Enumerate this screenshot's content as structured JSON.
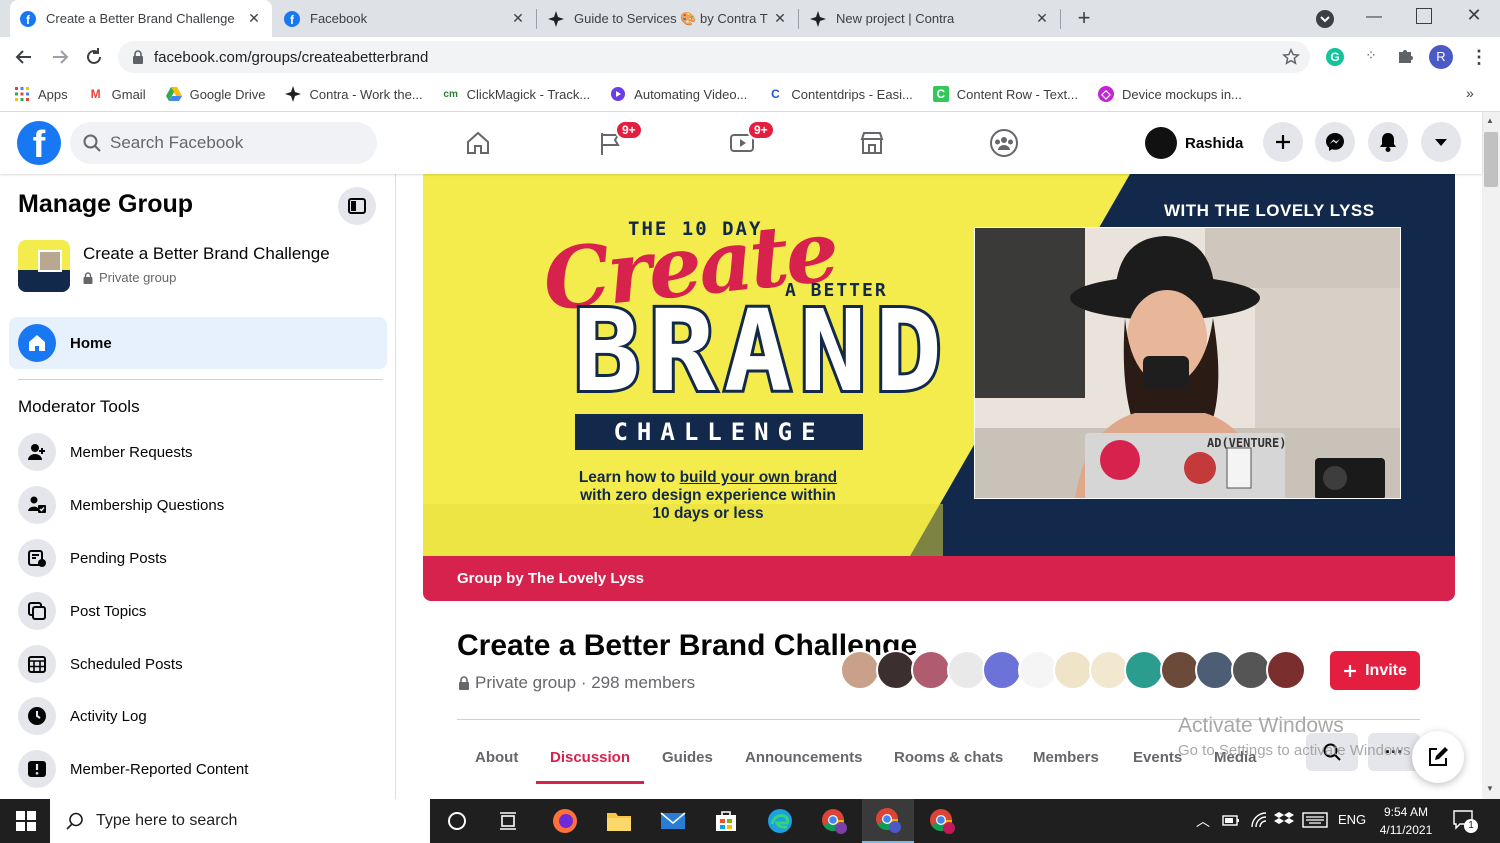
{
  "browser": {
    "tabs": [
      {
        "title": "Create a Better Brand Challenge",
        "icon": "facebook-icon",
        "active": true
      },
      {
        "title": "Facebook",
        "icon": "facebook-icon",
        "active": false
      },
      {
        "title": "Guide to Services 🎨 by Contra T",
        "icon": "contra-icon",
        "active": false
      },
      {
        "title": "New project | Contra",
        "icon": "contra-icon",
        "active": false
      }
    ],
    "url": "facebook.com/groups/createabetterbrand",
    "profile_initial": "R",
    "bookmarks": [
      {
        "label": "Apps",
        "icon": "apps-grid-icon"
      },
      {
        "label": "Gmail",
        "icon": "gmail-icon"
      },
      {
        "label": "Google Drive",
        "icon": "google-drive-icon"
      },
      {
        "label": "Contra - Work the...",
        "icon": "contra-icon"
      },
      {
        "label": "ClickMagick - Track...",
        "icon": "clickmagick-icon"
      },
      {
        "label": "Automating Video...",
        "icon": "video-icon"
      },
      {
        "label": "Contentdrips - Easi...",
        "icon": "contentdrips-icon"
      },
      {
        "label": "Content Row - Text...",
        "icon": "content-row-icon"
      },
      {
        "label": "Device mockups in...",
        "icon": "device-mockups-icon"
      }
    ]
  },
  "fb_header": {
    "search_placeholder": "Search Facebook",
    "groups_badge": "9+",
    "watch_badge": "9+",
    "user_name": "Rashida"
  },
  "sidebar": {
    "title": "Manage Group",
    "group_name": "Create a Better Brand Challenge",
    "group_privacy": "Private group",
    "home_label": "Home",
    "moderator_heading": "Moderator Tools",
    "tools": [
      {
        "label": "Member Requests",
        "icon": "member-requests-icon"
      },
      {
        "label": "Membership Questions",
        "icon": "membership-questions-icon"
      },
      {
        "label": "Pending Posts",
        "icon": "pending-posts-icon"
      },
      {
        "label": "Post Topics",
        "icon": "post-topics-icon"
      },
      {
        "label": "Scheduled Posts",
        "icon": "scheduled-posts-icon"
      },
      {
        "label": "Activity Log",
        "icon": "activity-log-icon"
      },
      {
        "label": "Member-Reported Content",
        "icon": "reported-content-icon"
      }
    ]
  },
  "cover": {
    "the_10_day": "THE 10 DAY",
    "create": "Create",
    "a_better": "A BETTER",
    "brand": "BRAND",
    "challenge": "CHALLENGE",
    "tagline_1_prefix": "Learn how to ",
    "tagline_1_link": "build your own brand",
    "tagline_2": "with zero design experience within",
    "tagline_3": "10 days or less",
    "with_lyss": "WITH THE LOVELY LYSS",
    "band_text": "Group by The Lovely Lyss",
    "photo_laptop_text": "AD(VENTURE)"
  },
  "group": {
    "name": "Create a Better Brand Challenge",
    "meta": "Private group · 298 members",
    "invite_label": "Invite",
    "avatar_count": 13,
    "tabs": [
      "About",
      "Discussion",
      "Guides",
      "Announcements",
      "Rooms & chats",
      "Members",
      "Events",
      "Media"
    ],
    "active_tab": "Discussion"
  },
  "watermark": {
    "line1": "Activate Windows",
    "line2": "Go to Settings to activate Windows."
  },
  "taskbar": {
    "search_placeholder": "Type here to search",
    "language": "ENG",
    "time": "9:54 AM",
    "date": "4/11/2021",
    "notification_count": "1"
  },
  "colors": {
    "fb_blue": "#1877f2",
    "cover_yellow": "#f4ec4c",
    "cover_navy": "#13294b",
    "cover_red": "#d7224e",
    "invite_red": "#e41e3f"
  }
}
